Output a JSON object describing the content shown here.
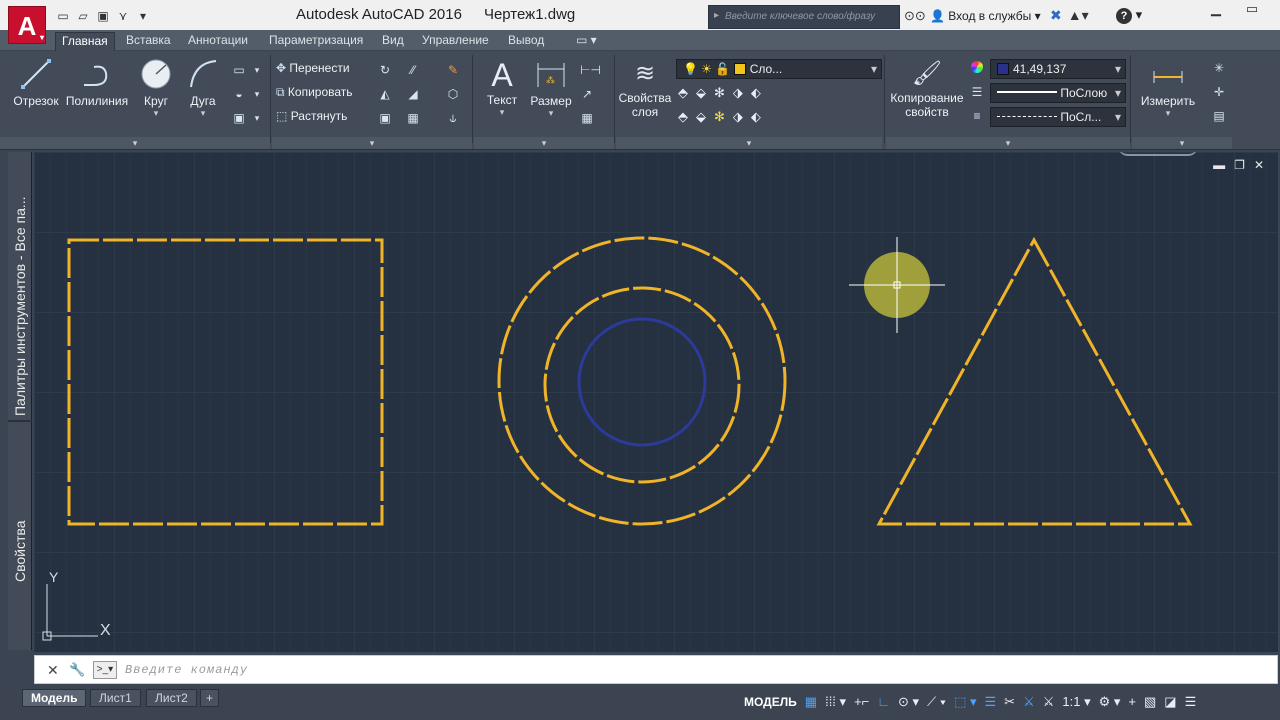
{
  "app": {
    "logo_letter": "A",
    "title": "Autodesk AutoCAD 2016",
    "document": "Чертеж1.dwg",
    "search_placeholder": "Введите ключевое слово/фразу",
    "signin": "Вход в службы",
    "help_symbol": "?"
  },
  "tabs": [
    "Главная",
    "Вставка",
    "Аннотации",
    "Параметризация",
    "Вид",
    "Управление",
    "Вывод"
  ],
  "ribbon": {
    "draw": {
      "line": "Отрезок",
      "polyline": "Полилиния",
      "circle": "Круг",
      "arc": "Дуга"
    },
    "modify": {
      "move": "Перенести",
      "copy": "Копировать",
      "stretch": "Растянуть"
    },
    "annotation": {
      "text": "Текст",
      "dimension": "Размер"
    },
    "layers": {
      "props_line1": "Свойства",
      "props_line2": "слоя",
      "layer_name": "Сло..."
    },
    "properties": {
      "match_line1": "Копирование",
      "match_line2": "свойств",
      "color": "41,49,137",
      "linetype": "ПоСлою",
      "lineweight": "ПоСл..."
    },
    "utilities": {
      "measure": "Измерить"
    }
  },
  "palettes": {
    "tool_palettes": "Палитры инструментов - Все па...",
    "properties": "Свойства"
  },
  "ucs": {
    "x": "X",
    "y": "Y"
  },
  "command": {
    "placeholder": "Введите команду"
  },
  "layout_tabs": [
    "Модель",
    "Лист1",
    "Лист2"
  ],
  "status": {
    "model": "МОДЕЛЬ",
    "scale": "1:1"
  },
  "colors": {
    "object_yellow": "#f0b429",
    "inner_circle": "#2c3a9a",
    "canvas": "#253140",
    "ribbon": "#434b58",
    "logo": "#c8102e"
  }
}
